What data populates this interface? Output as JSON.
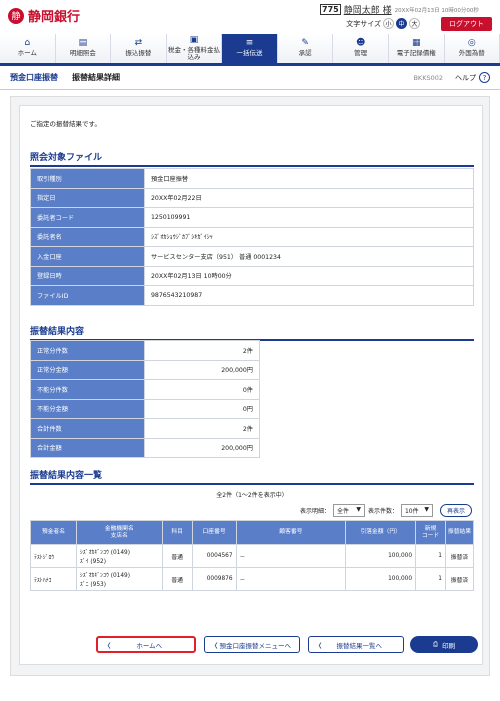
{
  "header": {
    "bank_name": "静岡銀行",
    "badge": "775",
    "user_name": "静岡太郎 様",
    "last_login": "20XX年02月13日 10時00分00秒",
    "font_size_label": "文字サイズ",
    "font_sizes": [
      "小",
      "中",
      "大"
    ],
    "logout": "ログアウト"
  },
  "nav": [
    "ホーム",
    "明細照会",
    "振込振替",
    "税金・各種料金払込み",
    "一括伝送",
    "承認",
    "管理",
    "電子記録債権",
    "外国為替"
  ],
  "page": {
    "section": "預金口座振替",
    "title": "振替結果詳細",
    "screen_id": "BKKS002",
    "help": "ヘルプ",
    "message": "ご指定の振替結果です。"
  },
  "file_section": {
    "title": "照会対象ファイル",
    "rows": [
      [
        "取引種別",
        "預金口座振替"
      ],
      [
        "指定日",
        "20XX年02月22日"
      ],
      [
        "委託者コード",
        "1250109991"
      ],
      [
        "委託者名",
        "ｼｽﾞｵｶｼｮｳｼﾞｶﾌﾞｼｷｶﾞｲｼｬ"
      ],
      [
        "入金口座",
        "サービスセンター支店（951） 普通 0001234"
      ],
      [
        "登録日時",
        "20XX年02月13日 10時00分"
      ],
      [
        "ファイルID",
        "9876543210987"
      ]
    ]
  },
  "result_section": {
    "title": "振替結果内容",
    "rows": [
      [
        "正常分件数",
        "2件"
      ],
      [
        "正常分金額",
        "200,000円"
      ],
      [
        "不能分件数",
        "0件"
      ],
      [
        "不能分金額",
        "0円"
      ],
      [
        "合計件数",
        "2件"
      ],
      [
        "合計金額",
        "200,000円"
      ]
    ]
  },
  "list_section": {
    "title": "振替結果内容一覧",
    "count": "全2件（1～2件を表示中）",
    "filter_label": "表示明細：",
    "filter_value": "全件",
    "per_page_label": "表示件数：",
    "per_page_value": "10件",
    "redisplay": "再表示",
    "headers": [
      "預金者名",
      "金融機関名\n支店名",
      "科目",
      "口座番号",
      "顧客番号",
      "引落金額（円）",
      "新規\nコード",
      "振替結果"
    ],
    "rows": [
      [
        "ﾃｽﾄｼﾞﾛｳ",
        "ｼｽﾞｵｶｷﾞﾝｺｳ (0149)\nｽﾞｲ (952)",
        "普通",
        "0004567",
        "－",
        "100,000",
        "1",
        "振替済"
      ],
      [
        "ﾃｽﾄﾊﾅｺ",
        "ｼｽﾞｵｶｷﾞﾝｺｳ (0149)\nｽﾞﾆ (953)",
        "普通",
        "0009876",
        "－",
        "100,000",
        "1",
        "振替済"
      ]
    ]
  },
  "buttons": {
    "home": "ホームへ",
    "menu": "預金口座振替メニューへ",
    "list": "振替結果一覧へ",
    "print": "印刷"
  }
}
